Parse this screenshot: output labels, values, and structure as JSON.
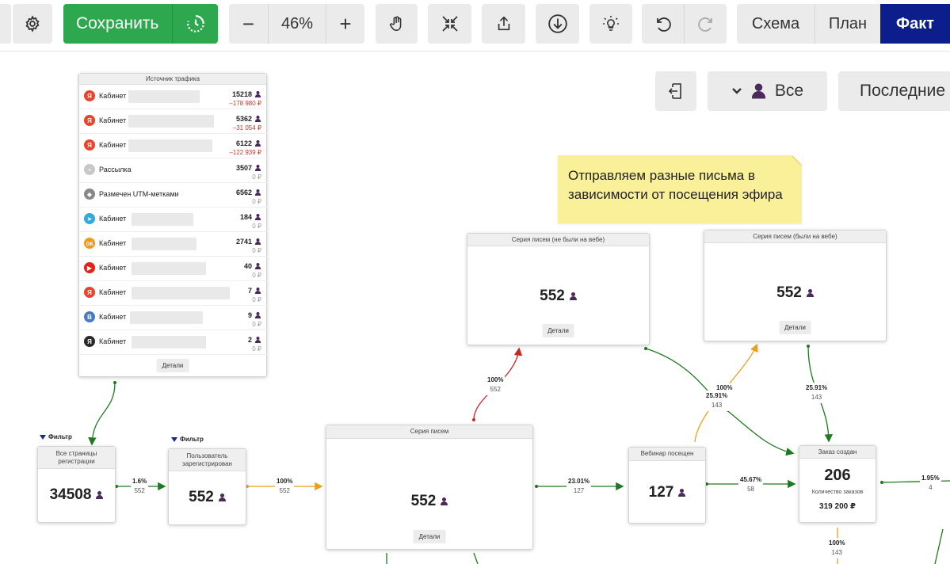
{
  "toolbar": {
    "save_label": "Сохранить",
    "zoom_value": "46%",
    "zoom_minus": "−",
    "zoom_plus": "+",
    "view_tabs": [
      "Схема",
      "План",
      "Факт"
    ],
    "active_view": "Факт",
    "active_color": "#0c1e8c",
    "save_color": "#2ea84f"
  },
  "filters": {
    "all_label": "Все",
    "period_label": "Последние"
  },
  "note": {
    "text": "Отправляем разные письма в зависимости от посещения эфира"
  },
  "traffic_source": {
    "title": "Источник трафика",
    "details_label": "Детали",
    "rows": [
      {
        "icon": "yandex-icon",
        "color": "#e8452c",
        "glyph": "Я",
        "label": "Кабинет",
        "count": "15218",
        "money": "–178 980 ₽",
        "neg": true
      },
      {
        "icon": "yandex-icon",
        "color": "#e8452c",
        "glyph": "Я",
        "label": "Кабинет",
        "count": "5362",
        "money": "–31 054 ₽",
        "neg": true
      },
      {
        "icon": "yandex-icon",
        "color": "#e8452c",
        "glyph": "Я",
        "label": "Кабинет",
        "count": "6122",
        "money": "–122 939 ₽",
        "neg": true
      },
      {
        "icon": "mailing-icon",
        "color": "#c8c8c8",
        "glyph": "•",
        "label": "Рассылка",
        "count": "3507",
        "money": "0 ₽",
        "neg": false
      },
      {
        "icon": "tag-icon",
        "color": "#888888",
        "glyph": "◆",
        "label": "Размечен UTM-метками",
        "count": "6562",
        "money": "0 ₽",
        "neg": false
      },
      {
        "icon": "telegram-icon",
        "color": "#37a8dc",
        "glyph": "➤",
        "label": "Кабинет",
        "count": "184",
        "money": "0 ₽",
        "neg": false
      },
      {
        "icon": "odnoklassniki-icon",
        "color": "#f09a1c",
        "glyph": "ок",
        "label": "Кабинет",
        "count": "2741",
        "money": "0 ₽",
        "neg": false
      },
      {
        "icon": "youtube-icon",
        "color": "#e62117",
        "glyph": "▶",
        "label": "Кабинет",
        "count": "40",
        "money": "0 ₽",
        "neg": false
      },
      {
        "icon": "yandex-icon",
        "color": "#e8452c",
        "glyph": "Я",
        "label": "Кабинет",
        "count": "7",
        "money": "0 ₽",
        "neg": false
      },
      {
        "icon": "vk-icon",
        "color": "#4a78c2",
        "glyph": "В",
        "label": "Кабинет",
        "count": "9",
        "money": "0 ₽",
        "neg": false
      },
      {
        "icon": "yandex-dark-icon",
        "color": "#2a2a2a",
        "glyph": "Я",
        "label": "Кабинет",
        "count": "2",
        "money": "0 ₽",
        "neg": false
      }
    ]
  },
  "nodes": {
    "all_pages": {
      "filter": "Фильтр",
      "title": "Все страницы регистрации",
      "value": "34508"
    },
    "registered": {
      "filter": "Фильтр",
      "title": "Пользователь зарегистрирован",
      "value": "552"
    },
    "email_series": {
      "title": "Серия писем",
      "value": "552",
      "details": "Детали"
    },
    "series_not_web": {
      "title": "Серия писем (не были на вебе)",
      "value": "552",
      "details": "Детали"
    },
    "series_web": {
      "title": "Серия писем (были на вебе)",
      "value": "552",
      "details": "Детали"
    },
    "webinar": {
      "title": "Вебинар посещен",
      "value": "127"
    },
    "order": {
      "title": "Заказ создан",
      "value": "206",
      "subtitle": "Количество заказов",
      "money": "319 200 ₽"
    }
  },
  "edges": {
    "e1": {
      "pct": "1.6%",
      "n": "552"
    },
    "e2": {
      "pct": "100%",
      "n": "552"
    },
    "e3": {
      "pct": "100%",
      "n": "552"
    },
    "e4": {
      "pct": "23.01%",
      "n": "127"
    },
    "e5": {
      "pct": "45.67%",
      "n": "58"
    },
    "e6": {
      "pct": "100%",
      "n": ""
    },
    "e7": {
      "pct": "25.91%",
      "n": "143"
    },
    "e8": {
      "pct": "25.91%",
      "n": "143"
    },
    "e9": {
      "pct": "1.95%",
      "n": "4"
    },
    "e10": {
      "pct": "100%",
      "n": "143"
    }
  }
}
